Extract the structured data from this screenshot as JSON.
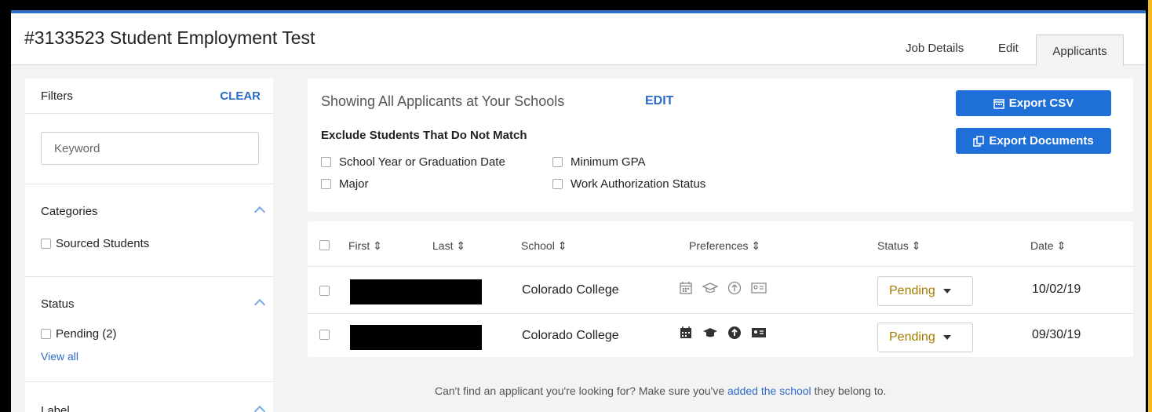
{
  "header": {
    "title": "#3133523 Student Employment Test",
    "tabs": [
      "Job Details",
      "Edit",
      "Applicants"
    ]
  },
  "filters": {
    "title": "Filters",
    "clear": "CLEAR",
    "keyword_placeholder": "Keyword",
    "categories_title": "Categories",
    "categories": [
      "Sourced Students"
    ],
    "status_title": "Status",
    "status_options": [
      "Pending (2)"
    ],
    "view_all": "View all",
    "label_title": "Label"
  },
  "panel": {
    "showing": "Showing All Applicants at Your Schools",
    "edit": "EDIT",
    "exclude_title": "Exclude Students That Do Not Match",
    "options": [
      "School Year or Graduation Date",
      "Minimum GPA",
      "Major",
      "Work Authorization Status"
    ],
    "export_csv": "Export CSV",
    "export_docs": "Export Documents"
  },
  "table": {
    "columns": [
      "First",
      "Last",
      "School",
      "Preferences",
      "Status",
      "Date"
    ],
    "rows": [
      {
        "school": "Colorado College",
        "status": "Pending",
        "date": "10/02/19"
      },
      {
        "school": "Colorado College",
        "status": "Pending",
        "date": "09/30/19"
      }
    ]
  },
  "footer": {
    "text_before": "Can't find an applicant you're looking for? Make sure you've ",
    "link": "added the school",
    "text_after": " they belong to."
  },
  "colors": {
    "accent": "#1f6fd8",
    "pending": "#a67c00",
    "page_bg": "#f3f3f3"
  }
}
